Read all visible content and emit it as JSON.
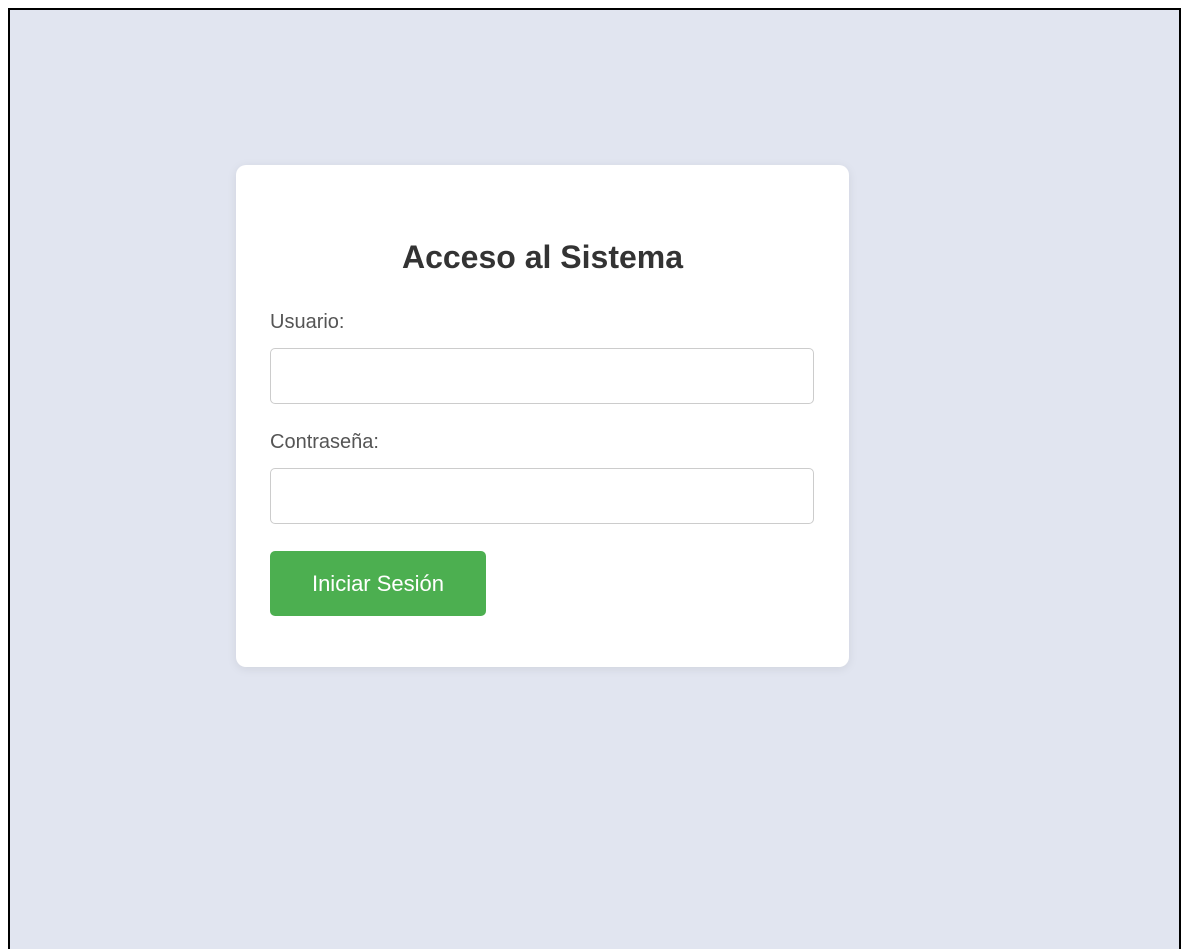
{
  "login": {
    "title": "Acceso al Sistema",
    "username_label": "Usuario:",
    "username_value": "",
    "password_label": "Contraseña:",
    "password_value": "",
    "submit_label": "Iniciar Sesión"
  },
  "colors": {
    "background": "#e1e5f0",
    "card": "#ffffff",
    "button": "#4caf50",
    "title_text": "#333333",
    "label_text": "#555555"
  }
}
